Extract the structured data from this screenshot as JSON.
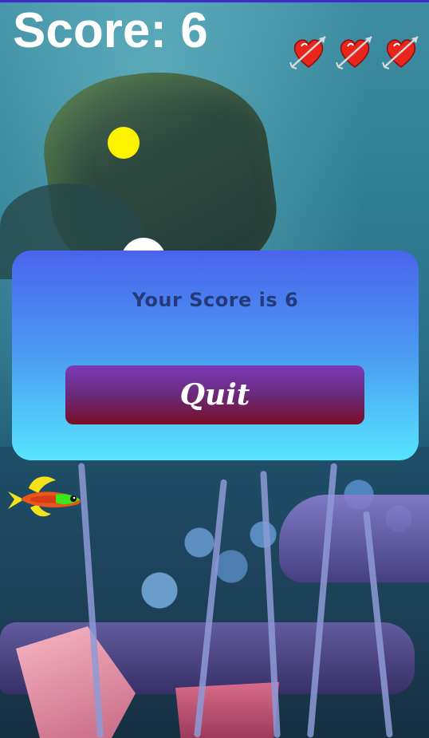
{
  "hud": {
    "score_text": "Score: 6",
    "lives": 3
  },
  "dialog": {
    "message": "Your Score is 6",
    "quit_label": "Quit"
  },
  "colors": {
    "dialog_top": "#4a63ec",
    "dialog_bottom": "#56e4fd",
    "button_top": "#7a3bb8",
    "button_bottom": "#7a0d25",
    "coin_yellow": "#fdf200",
    "coin_white": "#ffffff"
  },
  "icons": {
    "life": "heart-with-arrow-icon",
    "player": "fish-icon"
  }
}
